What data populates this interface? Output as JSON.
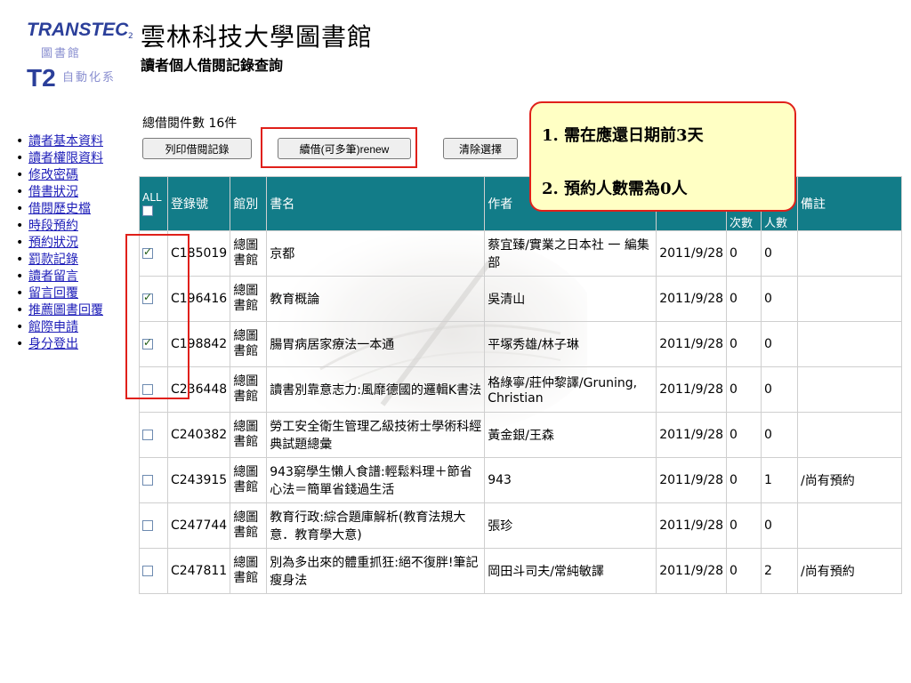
{
  "logo": {
    "brand": "TRANSTEC",
    "brand_sup": "2",
    "sub1": "圖書館",
    "mark": "T2",
    "sub2": "自動化系"
  },
  "header": {
    "title": "雲林科技大學圖書館",
    "subtitle": "讀者個人借閱記錄查詢"
  },
  "sidebar": {
    "items": [
      {
        "label": "讀者基本資料"
      },
      {
        "label": "讀者權限資料"
      },
      {
        "label": "修改密碼"
      },
      {
        "label": "借書狀況"
      },
      {
        "label": "借閱歷史檔"
      },
      {
        "label": "時段預約"
      },
      {
        "label": "預約狀況"
      },
      {
        "label": "罰款記錄"
      },
      {
        "label": "讀者留言"
      },
      {
        "label": "留言回覆"
      },
      {
        "label": "推薦圖書回覆"
      },
      {
        "label": "館際申請"
      },
      {
        "label": "身分登出"
      }
    ]
  },
  "summary": {
    "total": "總借閱件數 16件"
  },
  "toolbar": {
    "print": "列印借閱記錄",
    "renew": "續借(可多筆)renew",
    "clear": "清除選擇"
  },
  "callout": {
    "line1": "1. 需在應還日期前3天",
    "line2": "2. 預約人數需為0人"
  },
  "table": {
    "headers": {
      "all": "ALL",
      "barcode": "登錄號",
      "library": "館別",
      "title": "書名",
      "author": "作者",
      "renew_count": "次數",
      "reserve_count": "人數",
      "note": "備註"
    },
    "rows": [
      {
        "checked": true,
        "barcode": "C185019",
        "library": "總圖書館",
        "title": "京都",
        "author": "蔡宜臻/實業之日本社 一 編集部",
        "due": "2011/9/28",
        "renew": "0",
        "reserve": "0",
        "note": ""
      },
      {
        "checked": true,
        "barcode": "C196416",
        "library": "總圖書館",
        "title": "教育概論",
        "author": "吳清山",
        "due": "2011/9/28",
        "renew": "0",
        "reserve": "0",
        "note": ""
      },
      {
        "checked": true,
        "barcode": "C198842",
        "library": "總圖書館",
        "title": "腸胃病居家療法一本通",
        "author": "平塚秀雄/林子琳",
        "due": "2011/9/28",
        "renew": "0",
        "reserve": "0",
        "note": ""
      },
      {
        "checked": false,
        "barcode": "C236448",
        "library": "總圖書館",
        "title": "讀書別靠意志力:風靡德國的邏輯K書法",
        "author": "格綠寧/莊仲黎譯/Gruning, Christian",
        "due": "2011/9/28",
        "renew": "0",
        "reserve": "0",
        "note": ""
      },
      {
        "checked": false,
        "barcode": "C240382",
        "library": "總圖書館",
        "title": "勞工安全衛生管理乙級技術士學術科經典試題總彙",
        "author": "黃金銀/王森",
        "due": "2011/9/28",
        "renew": "0",
        "reserve": "0",
        "note": ""
      },
      {
        "checked": false,
        "barcode": "C243915",
        "library": "總圖書館",
        "title": "943窮學生懶人食譜:輕鬆料理＋節省心法＝簡單省錢過生活",
        "author": "943",
        "due": "2011/9/28",
        "renew": "0",
        "reserve": "1",
        "note": "/尚有預約"
      },
      {
        "checked": false,
        "barcode": "C247744",
        "library": "總圖書館",
        "title": "教育行政:綜合題庫解析(教育法規大意．教育學大意)",
        "author": "張珍",
        "due": "2011/9/28",
        "renew": "0",
        "reserve": "0",
        "note": ""
      },
      {
        "checked": false,
        "barcode": "C247811",
        "library": "總圖書館",
        "title": "別為多出來的體重抓狂:絕不復胖!筆記瘦身法",
        "author": "岡田斗司夫/常純敏譯",
        "due": "2011/9/28",
        "renew": "0",
        "reserve": "2",
        "note": "/尚有預約"
      }
    ]
  },
  "colors": {
    "header_bg": "#127c88",
    "link": "#1d1db8",
    "highlight": "#e0201a",
    "callout_bg": "#ffffc4"
  }
}
